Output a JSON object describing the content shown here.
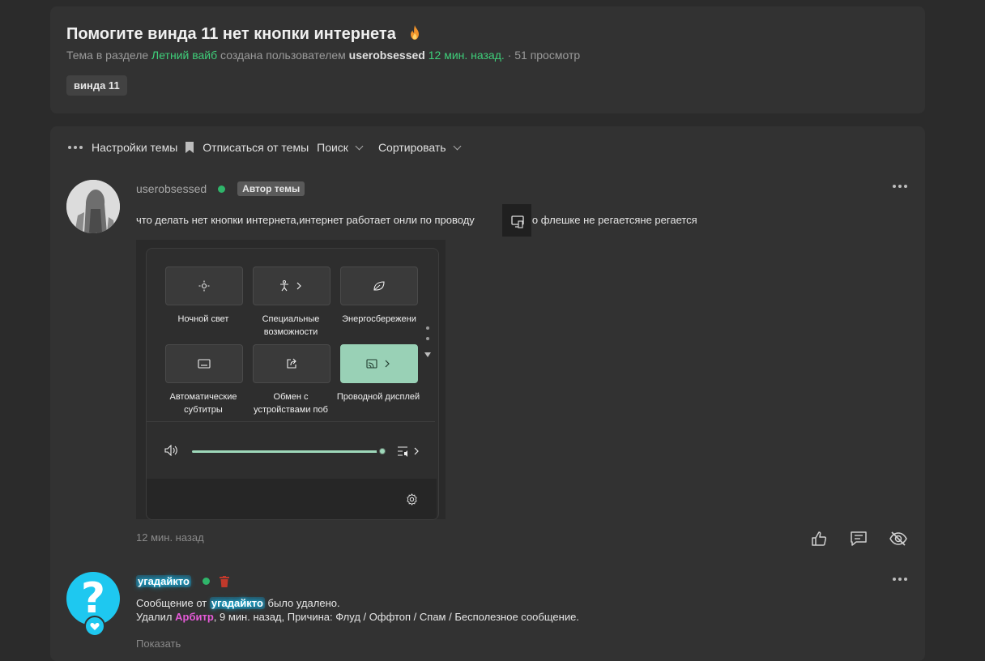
{
  "thread": {
    "title": "Помогите винда 11 нет кнопки интернета",
    "meta_prefix": "Тема в разделе",
    "section": "Летний вайб",
    "meta_created_by": "создана пользователем",
    "author": "userobsessed",
    "created": "12 мин. назад.",
    "views": "· 51 просмотр",
    "tag": "винда 11"
  },
  "toolbar": {
    "settings": "Настройки темы",
    "unsubscribe": "Отписаться от темы",
    "search": "Поиск",
    "sort": "Сортировать"
  },
  "post1": {
    "author": "userobsessed",
    "badge": "Автор темы",
    "text_before": "что делать нет кнопки интернета,интернет работает онли по проводу",
    "text_after": "а по флешке не регаетсяне регается",
    "time": "12 мин. назад",
    "quick_settings": {
      "tiles": [
        {
          "label": "Ночной свет",
          "icon": "brightness-icon"
        },
        {
          "label": "Специальные возможности",
          "icon": "accessibility-icon"
        },
        {
          "label": "Энергосбережени",
          "icon": "leaf-icon"
        },
        {
          "label": "Автоматические субтитры",
          "icon": "captions-icon"
        },
        {
          "label": "Обмен с устройствами поб",
          "icon": "share-icon"
        },
        {
          "label": "Проводной дисплей",
          "icon": "cast-icon"
        }
      ],
      "volume_level": 0.95,
      "accent": "#99d1b6"
    }
  },
  "post2": {
    "author": "угадайкто",
    "deleted_prefix": "Сообщение от",
    "deleted_suffix": "было удалено.",
    "removed_by_prefix": "Удалил",
    "moderator": "Арбитр",
    "removed_details": ", 9 мин. назад, Причина: Флуд / Оффтоп / Спам / Бесполезное сообщение.",
    "show": "Показать"
  },
  "colors": {
    "accent_green": "#3fcf7a",
    "online": "#2fb56a",
    "glow": "#19c6f5",
    "moderator": "#e55ad7"
  }
}
